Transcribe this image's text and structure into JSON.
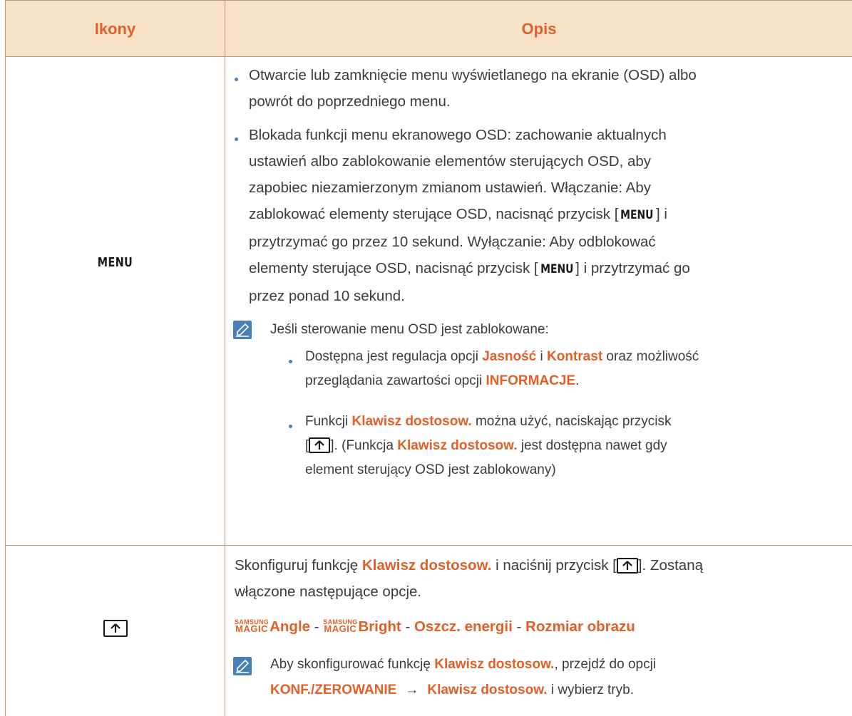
{
  "header": {
    "col1": "Ikony",
    "col2": "Opis"
  },
  "row1": {
    "icon_label": "MENU",
    "bullet1_line1": "Otwarcie lub zamknięcie menu wyświetlanego na ekranie (OSD) albo",
    "bullet1_line2": "powrót do poprzedniego menu.",
    "bullet2_line1": "Blokada funkcji menu ekranowego OSD: zachowanie aktualnych",
    "bullet2_line2": "ustawień albo zablokowanie elementów sterujących OSD, aby",
    "bullet2_line3": "zapobiec niezamierzonym zmianom ustawień. Włączanie: Aby",
    "bullet2_line4a": "zablokować elementy sterujące OSD, nacisnąć przycisk [",
    "bullet2_key1": "MENU",
    "bullet2_line4b": "] i",
    "bullet2_line5": "przytrzymać go przez 10 sekund. Wyłączanie: Aby odblokować",
    "bullet2_line6a": "elementy sterujące OSD, nacisnąć przycisk [",
    "bullet2_key2": "MENU",
    "bullet2_line6b": "] i przytrzymać go",
    "bullet2_line7": "przez ponad 10 sekund.",
    "note_intro": "Jeśli sterowanie menu OSD jest zablokowane:",
    "sub1_a": "Dostępna jest regulacja opcji ",
    "sub1_hl1": "Jasność",
    "sub1_b": " i ",
    "sub1_hl2": "Kontrast",
    "sub1_c": " oraz możliwość",
    "sub1_d": "przeglądania zawartości opcji ",
    "sub1_hl3": "INFORMACJE",
    "sub1_e": ".",
    "sub2_a": "Funkcji ",
    "sub2_hl1": "Klawisz dostosow.",
    "sub2_b": " można użyć, naciskając przycisk",
    "sub2_c": "[",
    "sub2_d": "]. (Funkcja ",
    "sub2_hl2": "Klawisz dostosow.",
    "sub2_e": " jest dostępna nawet gdy",
    "sub2_f": "element sterujący OSD jest zablokowany)"
  },
  "row2": {
    "icon_name": "custom-key-icon",
    "line1_a": "Skonfiguruj funkcję ",
    "line1_hl": "Klawisz dostosow.",
    "line1_b": " i naciśnij przycisk [",
    "line1_c": "]. Zostaną",
    "line2": "włączone następujące opcje.",
    "magic_top": "SAMSUNG",
    "magic_bottom": "MAGIC",
    "opt1": "Angle",
    "sep": " - ",
    "opt2": "Bright",
    "opt3": "Oszcz. energii",
    "opt4": "Rozmiar obrazu",
    "note_a": "Aby skonfigurować funkcję ",
    "note_hl1": "Klawisz dostosow.",
    "note_b": ", przejdź do opcji",
    "note_hl2": "KONF./ZEROWANIE",
    "note_arrow": "→",
    "note_hl3": "Klawisz dostosow.",
    "note_c": " i wybierz tryb."
  },
  "colors": {
    "accent": "#e0602a",
    "header_bg": "#f8e2c8",
    "border": "#c49a72",
    "bullet": "#4a7fb5"
  }
}
